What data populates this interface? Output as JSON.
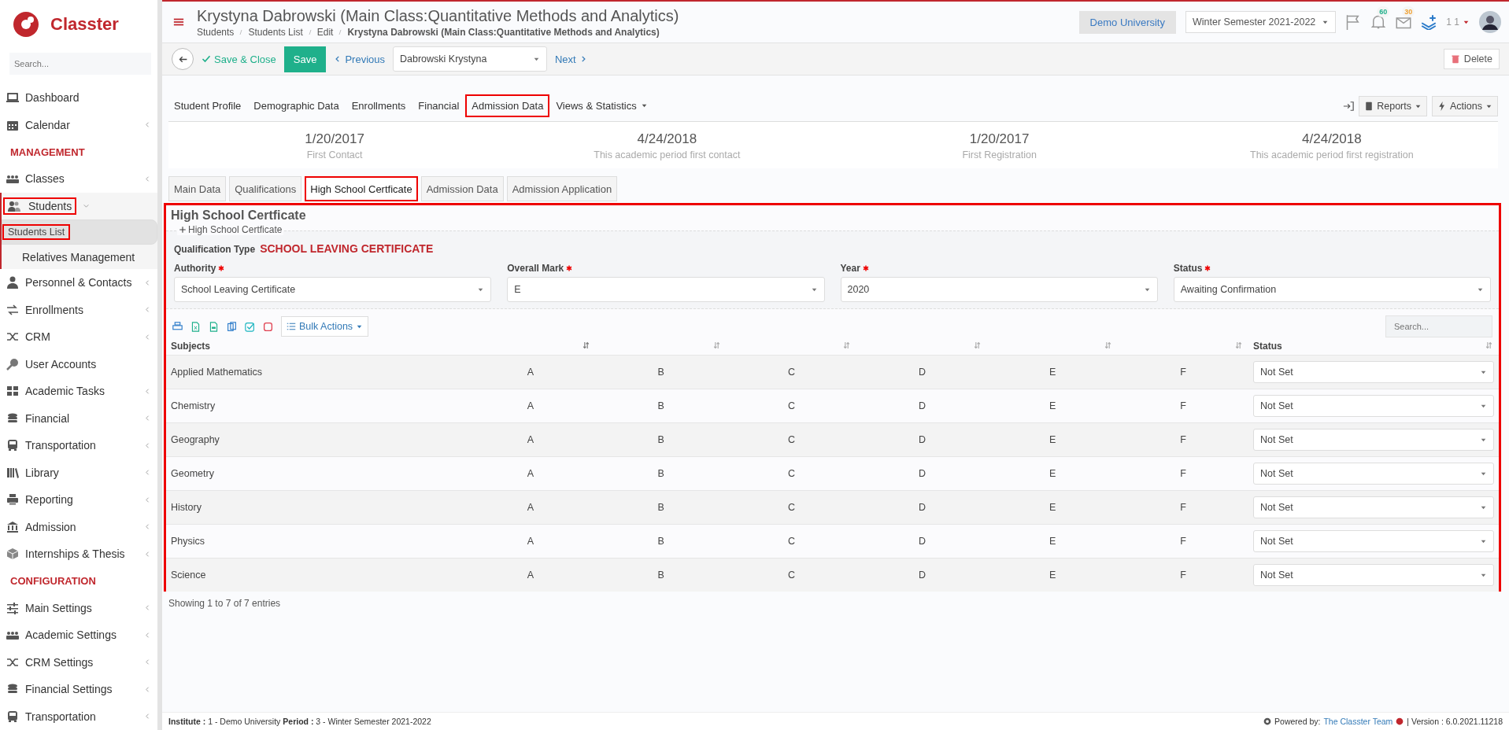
{
  "sidebar": {
    "logo": "Classter",
    "search": {
      "placeholder": "Search..."
    },
    "items": [
      {
        "kind": "item",
        "label": "Dashboard",
        "submenu": false,
        "highlighted": false,
        "selected": false
      },
      {
        "kind": "item",
        "label": "Calendar",
        "submenu": true,
        "highlighted": false,
        "selected": false
      },
      {
        "kind": "header",
        "label": "MANAGEMENT"
      },
      {
        "kind": "item",
        "label": "Classes",
        "submenu": true,
        "highlighted": false,
        "selected": false
      },
      {
        "kind": "item",
        "label": "Students",
        "submenu": true,
        "highlighted": true,
        "selected": false,
        "children": [
          {
            "label": "Students List",
            "selected": true,
            "highlighted": true
          },
          {
            "label": "Relatives Management",
            "selected": false,
            "highlighted": false
          }
        ]
      },
      {
        "kind": "item",
        "label": "Personnel & Contacts",
        "submenu": true,
        "highlighted": false,
        "selected": false
      },
      {
        "kind": "item",
        "label": "Enrollments",
        "submenu": true,
        "highlighted": false,
        "selected": false
      },
      {
        "kind": "item",
        "label": "CRM",
        "submenu": true,
        "highlighted": false,
        "selected": false
      },
      {
        "kind": "item",
        "label": "User Accounts",
        "submenu": false,
        "highlighted": false,
        "selected": false
      },
      {
        "kind": "item",
        "label": "Academic Tasks",
        "submenu": true,
        "highlighted": false,
        "selected": false
      },
      {
        "kind": "item",
        "label": "Financial",
        "submenu": true,
        "highlighted": false,
        "selected": false
      },
      {
        "kind": "item",
        "label": "Transportation",
        "submenu": true,
        "highlighted": false,
        "selected": false
      },
      {
        "kind": "item",
        "label": "Library",
        "submenu": true,
        "highlighted": false,
        "selected": false
      },
      {
        "kind": "item",
        "label": "Reporting",
        "submenu": true,
        "highlighted": false,
        "selected": false
      },
      {
        "kind": "item",
        "label": "Admission",
        "submenu": true,
        "highlighted": false,
        "selected": false
      },
      {
        "kind": "item",
        "label": "Internships & Thesis",
        "submenu": true,
        "highlighted": false,
        "selected": false
      },
      {
        "kind": "header",
        "label": "CONFIGURATION"
      },
      {
        "kind": "item",
        "label": "Main Settings",
        "submenu": true,
        "highlighted": false,
        "selected": false
      },
      {
        "kind": "item",
        "label": "Academic Settings",
        "submenu": true,
        "highlighted": false,
        "selected": false
      },
      {
        "kind": "item",
        "label": "CRM Settings",
        "submenu": true,
        "highlighted": false,
        "selected": false
      },
      {
        "kind": "item",
        "label": "Financial Settings",
        "submenu": true,
        "highlighted": false,
        "selected": false
      },
      {
        "kind": "item",
        "label": "Transportation",
        "submenu": true,
        "highlighted": false,
        "selected": false
      }
    ]
  },
  "header": {
    "title": "Krystyna Dabrowski (Main Class:Quantitative Methods and Analytics)",
    "breadcrumbs": [
      "Students",
      "Students List",
      "Edit",
      "Krystyna Dabrowski (Main Class:Quantitative Methods and Analytics)"
    ],
    "institution": "Demo University",
    "period": "Winter Semester 2021-2022",
    "notifications": "60",
    "messages": "30",
    "user": "1 1"
  },
  "toolbar": {
    "save_close": "Save & Close",
    "save": "Save",
    "previous": "Previous",
    "record": "Dabrowski Krystyna",
    "next": "Next",
    "delete": "Delete"
  },
  "tabs": [
    {
      "label": "Student Profile",
      "selected": false,
      "dropdown": false
    },
    {
      "label": "Demographic Data",
      "selected": false,
      "dropdown": false
    },
    {
      "label": "Enrollments",
      "selected": false,
      "dropdown": false
    },
    {
      "label": "Financial",
      "selected": false,
      "dropdown": false
    },
    {
      "label": "Admission Data",
      "selected": true,
      "dropdown": false
    },
    {
      "label": "Views & Statistics",
      "selected": false,
      "dropdown": true
    }
  ],
  "tab_actions": [
    "Reports",
    "Actions"
  ],
  "dates": [
    {
      "value": "1/20/2017",
      "label": "First Contact"
    },
    {
      "value": "4/24/2018",
      "label": "This academic period first contact"
    },
    {
      "value": "1/20/2017",
      "label": "First Registration"
    },
    {
      "value": "4/24/2018",
      "label": "This academic period first registration"
    }
  ],
  "subtabs": [
    {
      "label": "Main Data",
      "selected": false
    },
    {
      "label": "Qualifications",
      "selected": false
    },
    {
      "label": "High School Certficate",
      "selected": true
    },
    {
      "label": "Admission Data",
      "selected": false
    },
    {
      "label": "Admission Application",
      "selected": false
    }
  ],
  "panel": {
    "title": "High School Certficate",
    "legend": "High School Certficate",
    "qualification_label": "Qualification Type",
    "qualification_value": "SCHOOL LEAVING CERTIFICATE",
    "fields": [
      {
        "label": "Authority",
        "value": "School Leaving Certificate",
        "required": true
      },
      {
        "label": "Overall Mark",
        "value": "E",
        "required": true
      },
      {
        "label": "Year",
        "value": "2020",
        "required": true
      },
      {
        "label": "Status",
        "value": "Awaiting Confirmation",
        "required": true
      }
    ],
    "bulk_actions": "Bulk Actions",
    "search": {
      "placeholder": "Search..."
    },
    "table": {
      "columns": [
        "Subjects",
        "",
        "",
        "",
        "",
        "",
        "",
        "Status"
      ],
      "rows": [
        {
          "subject": "Applied Mathematics",
          "grades": [
            "A",
            "B",
            "C",
            "D",
            "E",
            "F"
          ],
          "status": "Not Set"
        },
        {
          "subject": "Chemistry",
          "grades": [
            "A",
            "B",
            "C",
            "D",
            "E",
            "F"
          ],
          "status": "Not Set"
        },
        {
          "subject": "Geography",
          "grades": [
            "A",
            "B",
            "C",
            "D",
            "E",
            "F"
          ],
          "status": "Not Set"
        },
        {
          "subject": "Geometry",
          "grades": [
            "A",
            "B",
            "C",
            "D",
            "E",
            "F"
          ],
          "status": "Not Set"
        },
        {
          "subject": "History",
          "grades": [
            "A",
            "B",
            "C",
            "D",
            "E",
            "F"
          ],
          "status": "Not Set"
        },
        {
          "subject": "Physics",
          "grades": [
            "A",
            "B",
            "C",
            "D",
            "E",
            "F"
          ],
          "status": "Not Set"
        },
        {
          "subject": "Science",
          "grades": [
            "A",
            "B",
            "C",
            "D",
            "E",
            "F"
          ],
          "status": "Not Set"
        }
      ]
    },
    "entries": "Showing 1 to 7 of 7 entries"
  },
  "footer": {
    "institute_label": "Institute :",
    "institute": "1 - Demo University",
    "period_label": "Period :",
    "period": "3 - Winter Semester 2021-2022",
    "powered": "Powered by:",
    "team": "The Classter Team",
    "version": "| Version : 6.0.2021.11218"
  }
}
